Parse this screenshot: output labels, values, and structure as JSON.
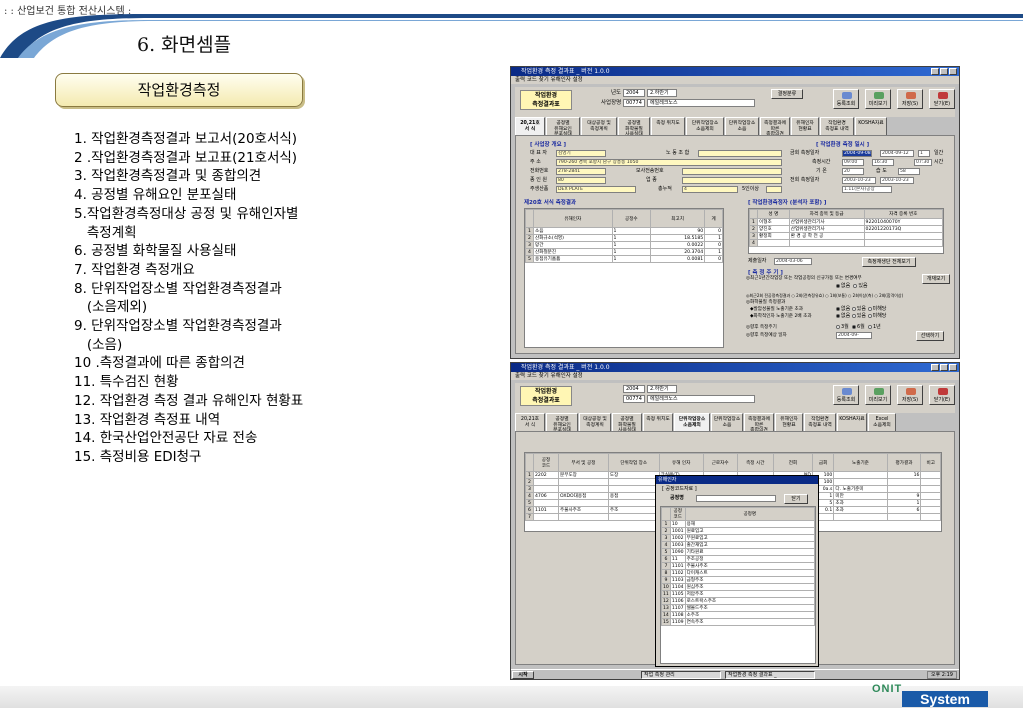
{
  "header": {
    "tag": ": : 산업보건 통합 전산시스템 :",
    "page_title": "6. 화면셈플"
  },
  "left": {
    "box_title": "작업환경측정",
    "items": [
      "1. 작업환경측정결과 보고서(20호서식)",
      "2 .작업환경측정결과 보고표(21호서식)",
      "3. 작업환경측정결과 및 종합의견",
      "4. 공정별 유해요인 분포실태",
      "5.작업환경측정대상 공정 및 유해인자별",
      "   측정계획",
      "6. 공정별 화학물질 사용실태",
      "7. 작업환경 측정개요",
      "8. 단위작업장소별 작업환경측정결과",
      "   (소음제외)",
      "9. 단위작업장소별 작업환경측정결과",
      "   (소음)",
      "10 .측정결과에 따른 종합의견",
      "11. 특수검진 현황",
      "12. 작업환경 측정 결과 유해인자 현황표",
      "13. 작업환경 측정표 내역",
      "14. 한국산업안전공단 자료 전송",
      "15. 측정비용 EDI청구"
    ]
  },
  "win1": {
    "title": "작업환경 측정 결과표 _ 버전 1.0.0",
    "menu": "출력  코드 찾기  유해인자  설정",
    "logo": "작업환경\n측정결과표",
    "year_label": "년도",
    "year_value": "2004",
    "half_value": "2.하반기",
    "company_label": "사업장명",
    "company_code": "00774",
    "company_name": "에일레크노스",
    "report_button": "결정분류",
    "toolbar": [
      "등록조회",
      "미리보기",
      "저장(S)",
      "닫기(E)"
    ],
    "tabs": [
      "20,21호\n서 식",
      "공정별\n유해요인\n분포실태",
      "대상공정 및\n측정계획",
      "공정별\n화학물질\n사용실태",
      "측정 위치도",
      "단위작업장소\n소음제외",
      "단위작업장소\n소음",
      "측정결과에\n따른\n종합의견",
      "유해인자\n현황표",
      "작업환경\n측정표 내역",
      "KOSHA자료"
    ],
    "sec_company": "[ 사업장 개요 ]",
    "company_fields": {
      "rep_label": "대 표 자",
      "rep_value": "김영기",
      "union_label": "노 동 조 합",
      "addr_label": "주   소",
      "addr_value": "790-260  경북 포항시 남구 장흥동 1050",
      "tel_label": "전화번호",
      "tel_value": "278-2841",
      "fax_label": "모사전송번호",
      "emp_label": "종 인 원",
      "emp_value": "80",
      "industry_label": "업      종",
      "product_label": "주생산품",
      "product_value": "DEX PLATE",
      "total_label": "총누적",
      "total_value": "4",
      "scale_label": "5인이상"
    },
    "sec_measure": "[ 작업환경 측정 일시 ]",
    "measure_fields": {
      "pre_label": "금회 측정일자",
      "pre_from": "2004-09-08",
      "pre_to": "2004-09-12",
      "days": "1",
      "days_unit": "일간",
      "time_label": "측정시간",
      "time_from": "09:00",
      "time_to": "16:30",
      "hours": "07:30",
      "hours_unit": "시간",
      "temp_label": "기   온",
      "temp_value": "20",
      "hum_label": "습   도",
      "hum_value": "58",
      "prev_label": "전회 측정일자",
      "prev_from": "2003-10-23",
      "prev_to": "2003-10-23",
      "org_value": "1.11(본사)공장"
    },
    "sec_result": "제20호 서식 측정결과",
    "result_headers": [
      "",
      "유해인자",
      "공정수",
      "최고치",
      "계"
    ],
    "result_rows": [
      [
        "1",
        "소음",
        "1",
        "90",
        "0"
      ],
      [
        "2",
        "산화규소(석영)",
        "1",
        "18.5185",
        "1"
      ],
      [
        "3",
        "망간",
        "1",
        "0.0022",
        "0"
      ],
      [
        "4",
        "산화철분진",
        "1",
        "20.3704",
        "1"
      ],
      [
        "5",
        "용접유기흄퓸",
        "1",
        "0.0081",
        "0"
      ]
    ],
    "sec_staff": "[ 작업환경측정자 (분석자 포함) ]",
    "staff_headers": [
      "",
      "성 명",
      "자격 종목 및 등급",
      "자격 증록 번호"
    ],
    "staff_rows": [
      [
        "1",
        "이형조",
        "산업위생관리기사",
        "92201040070Y"
      ],
      [
        "2",
        "양진호",
        "산업위생관리기사",
        "02201220173Q"
      ],
      [
        "3",
        "황정희",
        "환 경 공 학 전 공",
        ""
      ],
      [
        "4",
        "",
        "",
        ""
      ]
    ],
    "submit_label": "제출일자",
    "submit_value": "2004-03-06",
    "approve_button": "측정재생단 전체보기",
    "sec_cycle": "[ 측 정 주 기 ]",
    "cycle_q1": "◎최근1년간작업장 또는 작업공정의 신규가동 또는 변경여부",
    "cycle_opts": [
      "없음",
      "있음"
    ],
    "cycle_btn": "개재모기",
    "cycle_q2": "◎최근2회 전공정측정결과 ○ 2회(전측정유효) ○ 1회(보통) ○ 2회이상(측) ○ 2회(합격이상)",
    "cycle_q3": "◎화학물질 측정결과",
    "cycle_q4": "◆발암성물질 노출기준 초과",
    "cycle_q5": "◆화학적인자 노출기준 2배 초과",
    "cycle_opts2": [
      "없음",
      "있음",
      "미해당"
    ],
    "cycle_q6": "◎향후 측정주기",
    "cycle_opts3": [
      "3월",
      "6월",
      "1년"
    ],
    "cycle_q7": "◎향후 측정예상 일자",
    "cycle_date": "2004-09-",
    "cycle_btn2": "선택하기"
  },
  "win2": {
    "title": "작업환경 측정 결과표 _ 버전 1.0.0",
    "menu": "출력  코드 찾기  유해인자  설정",
    "logo": "작업환경\n측정결과표",
    "year_value": "2004",
    "half_value": "2.하반기",
    "company_code": "00774",
    "company_name": "에일레크노스",
    "toolbar": [
      "등록조회",
      "미리보기",
      "저장(S)",
      "닫기(E)"
    ],
    "tabs": [
      "20,21호\n서 식",
      "공정별\n유해요인\n분포실태",
      "대상공정 및\n측정계획",
      "공정별\n화학물질\n사용실태",
      "측정 위치도",
      "단위작업장소\n소음제외",
      "단위작업장소\n소음",
      "측정결과에\n따른\n종합의견",
      "유해인자\n현황표",
      "작업환경\n측정표 내역",
      "KOSHA자료",
      "Excel\n소음제외"
    ],
    "grid_headers": [
      "공정\n코드",
      "부서 및 공정",
      "단위작업 장소",
      "유해 인자",
      "근로자수",
      "측정 시간",
      "측정치",
      "전회",
      "금회",
      "노출기준",
      "평가결과",
      "측정방법",
      "비고"
    ],
    "grid_rows": [
      [
        "1",
        "2202",
        "분무도장",
        "도장",
        "크실렌(T)",
        "",
        "",
        "ND",
        "100",
        "",
        "16"
      ],
      [
        "2",
        "",
        "",
        "",
        "톨루엔",
        "",
        "",
        "0.0054",
        "100",
        "",
        ""
      ],
      [
        "3",
        "",
        "",
        "",
        "콜일레기용",
        "",
        "",
        "b=0.006",
        "0a.s",
        "다. 노출기준미",
        ""
      ],
      [
        "4",
        "4706",
        "OXDO대용접",
        "용접",
        "망간",
        "",
        "",
        "0.0022",
        "1",
        "미만",
        "9"
      ],
      [
        "5",
        "",
        "",
        "",
        "산화철분진",
        "",
        "",
        "20.3704",
        "5",
        "초과",
        "1"
      ],
      [
        "6",
        "1101",
        "주물사주조",
        "주조",
        "산화규소(석",
        "",
        "",
        "18.5185",
        "0.1",
        "초과",
        "6"
      ],
      [
        "7",
        "",
        "",
        "",
        "",
        "",
        "",
        "",
        "",
        "",
        ""
      ]
    ],
    "popup": {
      "title": "유해인자",
      "subtitle": "[ 공정코드자료 ]",
      "search_label": "공정명",
      "search_button": "닫기",
      "headers": [
        "공정\n코드",
        "공정명"
      ],
      "rows": [
        [
          "1",
          "10",
          "용해"
        ],
        [
          "2",
          "1001",
          "원료입고"
        ],
        [
          "3",
          "1002",
          "부원료입고"
        ],
        [
          "4",
          "1003",
          "출간재입고"
        ],
        [
          "5",
          "1090",
          "기타원료"
        ],
        [
          "6",
          "11",
          "주조공정"
        ],
        [
          "7",
          "1101",
          "주물사주조"
        ],
        [
          "8",
          "1102",
          "다이캐스트"
        ],
        [
          "9",
          "1103",
          "금형주조"
        ],
        [
          "10",
          "1104",
          "원심주조"
        ],
        [
          "11",
          "1105",
          "저압주조"
        ],
        [
          "12",
          "1106",
          "로스트왁스주조"
        ],
        [
          "13",
          "1107",
          "쉘몰드주조"
        ],
        [
          "14",
          "1108",
          "소주조"
        ],
        [
          "15",
          "1109",
          "연속주조"
        ]
      ]
    },
    "taskbar": {
      "start": "시작",
      "task1": "작업 측정 관리",
      "task2": "작업환경 측정 결과표 _",
      "clock": "오후 2:19"
    }
  },
  "footer": {
    "brand": "ONIT",
    "system": "System"
  }
}
